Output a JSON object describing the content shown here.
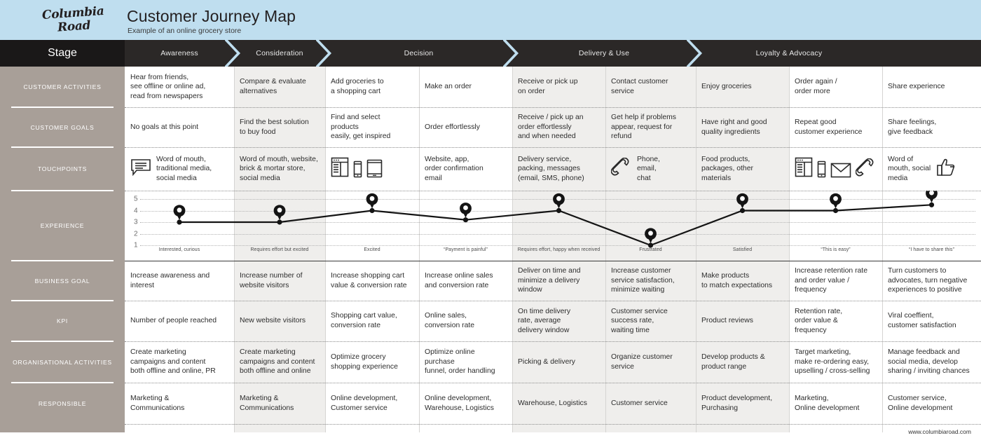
{
  "header": {
    "logo_line1": "Columbia",
    "logo_line2": "Road",
    "title": "Customer Journey Map",
    "subtitle": "Example of an online grocery store",
    "bg_color": "#bfdeef"
  },
  "stagebar": {
    "label": "Stage",
    "bg_color": "#231f20",
    "chevron_color": "#bfdeef",
    "stages": [
      {
        "label": "Awareness",
        "cols": 1
      },
      {
        "label": "Consideration",
        "cols": 1
      },
      {
        "label": "Decision",
        "cols": 2
      },
      {
        "label": "Delivery & Use",
        "cols": 2
      },
      {
        "label": "Loyalty & Advocacy",
        "cols": 2
      }
    ]
  },
  "sidebar": {
    "bg_color": "#a89f98",
    "items": [
      {
        "label": "CUSTOMER ACTIVITIES"
      },
      {
        "label": "CUSTOMER GOALS"
      },
      {
        "label": "TOUCHPOINTS"
      },
      {
        "label": "EXPERIENCE"
      },
      {
        "label": "BUSINESS GOAL"
      },
      {
        "label": "KPI"
      },
      {
        "label": "ORGANISATIONAL ACTIVITIES"
      },
      {
        "label": "RESPONSIBLE"
      }
    ]
  },
  "columns": [
    {
      "key": "awareness",
      "shaded": false
    },
    {
      "key": "consideration",
      "shaded": true
    },
    {
      "key": "cart",
      "shaded": false
    },
    {
      "key": "order",
      "shaded": false
    },
    {
      "key": "receive",
      "shaded": true
    },
    {
      "key": "support",
      "shaded": true
    },
    {
      "key": "enjoy",
      "shaded": true
    },
    {
      "key": "reorder",
      "shaded": false
    },
    {
      "key": "share",
      "shaded": false
    }
  ],
  "rows": {
    "customer_activities": [
      "Hear from friends,\nsee offline or online ad,\nread from newspapers",
      "Compare & evaluate\nalternatives",
      "Add groceries to\na shopping cart",
      "Make an order",
      "Receive or pick up\non order",
      "Contact customer\nservice",
      "Enjoy groceries",
      "Order again /\norder more",
      "Share experience"
    ],
    "customer_goals": [
      "No goals at this point",
      "Find the best solution\nto buy food",
      "Find and select\nproducts\neasily, get inspired",
      "Order effortlessly",
      "Receive / pick up an\norder effortlessly\nand when needed",
      "Get help if problems\nappear, request for\nrefund",
      "Have right and good\nquality ingredients",
      "Repeat good\ncustomer experience",
      "Share feelings,\ngive feedback"
    ],
    "touchpoints": [
      {
        "text": "Word of mouth,\ntraditional media,\nsocial media",
        "icons": [
          "speech-bubble-icon"
        ],
        "icons_first": true
      },
      {
        "text": "Word of mouth, website,\nbrick & mortar store,\nsocial media",
        "icons": [],
        "icons_first": false
      },
      {
        "text": "",
        "icons": [
          "browser-window-icon",
          "smartphone-icon",
          "tablet-icon"
        ],
        "icons_first": true
      },
      {
        "text": "Website, app,\norder confirmation\nemail",
        "icons": [],
        "icons_first": false
      },
      {
        "text": "Delivery service,\npacking, messages\n(email, SMS, phone)",
        "icons": [],
        "icons_first": false
      },
      {
        "text": "Phone,\nemail,\nchat",
        "icons": [
          "phone-handset-icon"
        ],
        "icons_first": true
      },
      {
        "text": "Food products,\npackages, other\nmaterials",
        "icons": [],
        "icons_first": false
      },
      {
        "text": "",
        "icons": [
          "browser-window-icon",
          "smartphone-icon",
          "envelope-icon",
          "phone-handset-icon"
        ],
        "icons_first": true
      },
      {
        "text": "Word of\nmouth, social\nmedia",
        "icons": [
          "thumbs-up-icon"
        ],
        "icons_first": false
      }
    ],
    "business_goal": [
      "Increase awareness and\ninterest",
      "Increase number of\nwebsite visitors",
      "Increase shopping cart\nvalue & conversion rate",
      "Increase online sales\nand conversion rate",
      "Deliver on time and\nminimize a delivery\nwindow",
      "Increase customer\nservice satisfaction,\nminimize waiting",
      "Make products\nto match expectations",
      "Increase retention rate\nand order value /\nfrequency",
      "Turn customers to\nadvocates, turn negative\nexperiences to positive"
    ],
    "kpi": [
      "Number of people reached",
      "New website visitors",
      "Shopping cart value,\nconversion rate",
      "Online sales,\nconversion rate",
      "On time delivery\nrate, average\ndelivery window",
      "Customer service\nsuccess rate,\nwaiting time",
      "Product reviews",
      "Retention rate,\norder value &\nfrequency",
      "Viral coeffient,\ncustomer satisfaction"
    ],
    "organisational_activities": [
      "Create marketing\ncampaigns and content\nboth offline and online, PR",
      "Create marketing\ncampaigns and content\nboth offline and online",
      "Optimize grocery\nshopping experience",
      "Optimize online\npurchase\nfunnel, order handling",
      "Picking & delivery",
      "Organize customer\nservice",
      "Develop products &\nproduct range",
      "Target marketing,\nmake re-ordering easy,\nupselling / cross-selling",
      "Manage feedback and\nsocial media, develop\nsharing / inviting chances"
    ],
    "responsible": [
      "Marketing &\nCommunications",
      "Marketing &\nCommunications",
      "Online development,\nCustomer service",
      "Online development,\nWarehouse, Logistics",
      "Warehouse, Logistics",
      "Customer service",
      "Product development,\nPurchasing",
      "Marketing,\nOnline development",
      "Customer service,\nOnline development"
    ]
  },
  "chart_data": {
    "type": "line",
    "title": "EXPERIENCE",
    "ylabel": "",
    "xlabel": "",
    "ylim": [
      1,
      5
    ],
    "yticks": [
      "5",
      "4",
      "3",
      "2",
      "1"
    ],
    "grid": true,
    "line_color": "#141414",
    "marker": "map-pin",
    "categories": [
      "Awareness",
      "Consideration",
      "Add to cart",
      "Make an order",
      "Receive order",
      "Contact support",
      "Enjoy groceries",
      "Order again",
      "Share experience"
    ],
    "values": [
      3,
      3,
      4,
      3.2,
      4,
      1,
      4,
      4,
      4.5
    ],
    "point_labels": [
      "Interested, curious",
      "Requires effort but excited",
      "Excited",
      "“Payment is painful”",
      "Requires effort, happy when received",
      "Frustrated",
      "Satisfied",
      "“This is easy”",
      "“I have to share this”"
    ]
  },
  "footer": {
    "url": "www.columbiaroad.com"
  }
}
